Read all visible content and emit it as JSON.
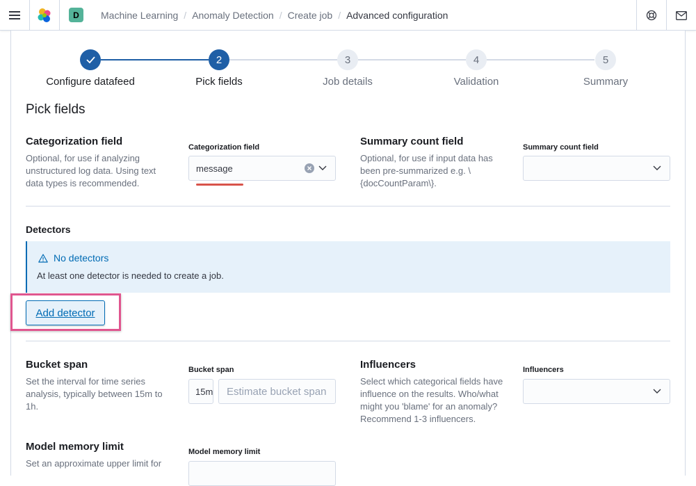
{
  "header": {
    "space_initial": "D",
    "breadcrumbs": [
      "Machine Learning",
      "Anomaly Detection",
      "Create job",
      "Advanced configuration"
    ],
    "separator": "/"
  },
  "steps": [
    {
      "number": "",
      "label": "Configure datafeed",
      "state": "done"
    },
    {
      "number": "2",
      "label": "Pick fields",
      "state": "current"
    },
    {
      "number": "3",
      "label": "Job details",
      "state": "todo"
    },
    {
      "number": "4",
      "label": "Validation",
      "state": "todo"
    },
    {
      "number": "5",
      "label": "Summary",
      "state": "todo"
    }
  ],
  "page_title": "Pick fields",
  "categorization": {
    "title": "Categorization field",
    "description": [
      "Optional, for use if analyzing",
      "unstructured log data. Using text",
      "data types is recommended."
    ],
    "label": "Categorization field",
    "value": "message"
  },
  "summary_count": {
    "title": "Summary count field",
    "description": [
      "Optional, for use if input data has",
      "been pre-summarized e.g. \\",
      "{docCountParam\\}."
    ],
    "label": "Summary count field",
    "value": ""
  },
  "detectors": {
    "title": "Detectors",
    "callout_title": "No detectors",
    "callout_body": "At least one detector is needed to create a job.",
    "add_button": "Add detector"
  },
  "bucket_span": {
    "title": "Bucket span",
    "description": [
      "Set the interval for time series",
      "analysis, typically between 15m to",
      "1h."
    ],
    "label": "Bucket span",
    "value": "15m",
    "estimate_placeholder": "Estimate bucket span"
  },
  "influencers": {
    "title": "Influencers",
    "description": [
      "Select which categorical fields have",
      "influence on the results. Who/what",
      "might you 'blame' for an anomaly?",
      "Recommend 1-3 influencers."
    ],
    "label": "Influencers"
  },
  "model_memory": {
    "title": "Model memory limit",
    "description": [
      "Set an approximate upper limit for"
    ],
    "label": "Model memory limit"
  },
  "colors": {
    "primary": "#006bb4",
    "step_active": "#1f5fa6",
    "highlight": "#e0568f"
  }
}
